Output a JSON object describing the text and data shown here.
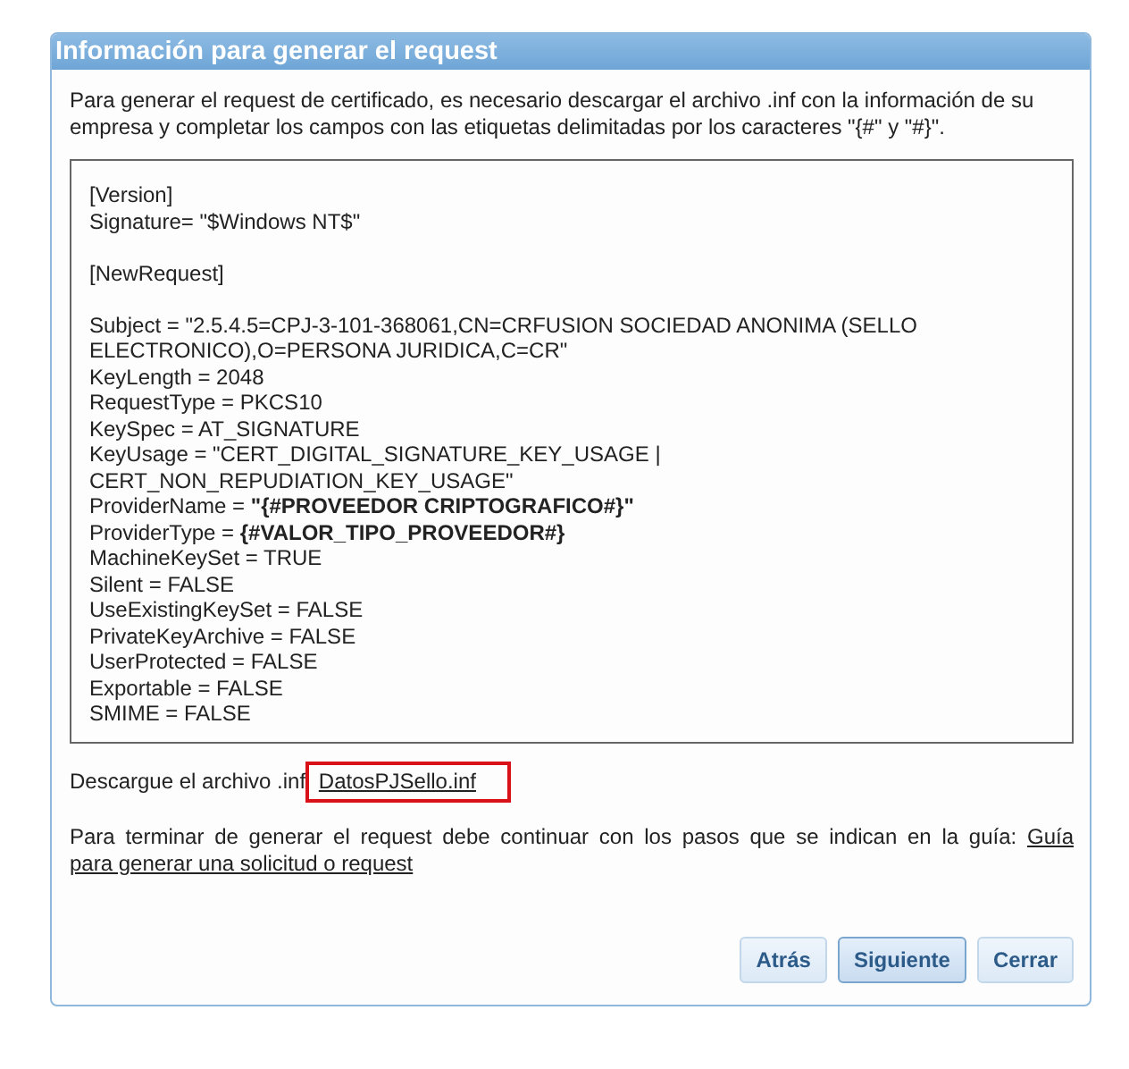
{
  "panel": {
    "title": "Información para generar el request"
  },
  "intro": "Para generar el request de certificado, es necesario descargar el archivo .inf con la información de su empresa y completar los campos con las etiquetas delimitadas por los caracteres \"{#\" y \"#}\".",
  "inf_file": {
    "blocks": [
      [
        "[Version]",
        "Signature= \"$Windows NT$\""
      ],
      [
        "[NewRequest]"
      ],
      [
        "Subject = \"2.5.4.5=CPJ-3-101-368061,CN=CRFUSION SOCIEDAD ANONIMA (SELLO ELECTRONICO),O=PERSONA JURIDICA,C=CR\"",
        "KeyLength = 2048",
        "RequestType = PKCS10",
        "KeySpec = AT_SIGNATURE",
        "KeyUsage = \"CERT_DIGITAL_SIGNATURE_KEY_USAGE | CERT_NON_REPUDIATION_KEY_USAGE\"",
        "ProviderName = **\"{#PROVEEDOR CRIPTOGRAFICO#}\"**",
        "ProviderType = **{#VALOR_TIPO_PROVEEDOR#}**",
        "MachineKeySet = TRUE",
        "Silent = FALSE",
        "UseExistingKeySet = FALSE",
        "PrivateKeyArchive = FALSE",
        "UserProtected = FALSE",
        "Exportable = FALSE",
        "SMIME = FALSE"
      ]
    ]
  },
  "download": {
    "label": "Descargue el archivo .inf",
    "link": "DatosPJSello.inf",
    "highlighted": true
  },
  "guide": {
    "text": "Para terminar de generar el request debe continuar con los pasos que se indican en la guía:",
    "link_parts": [
      "Guía",
      "para generar una solicitud o request"
    ]
  },
  "buttons": [
    {
      "label": "Atrás",
      "selected": false
    },
    {
      "label": "Siguiente",
      "selected": true
    },
    {
      "label": "Cerrar",
      "selected": false
    }
  ]
}
